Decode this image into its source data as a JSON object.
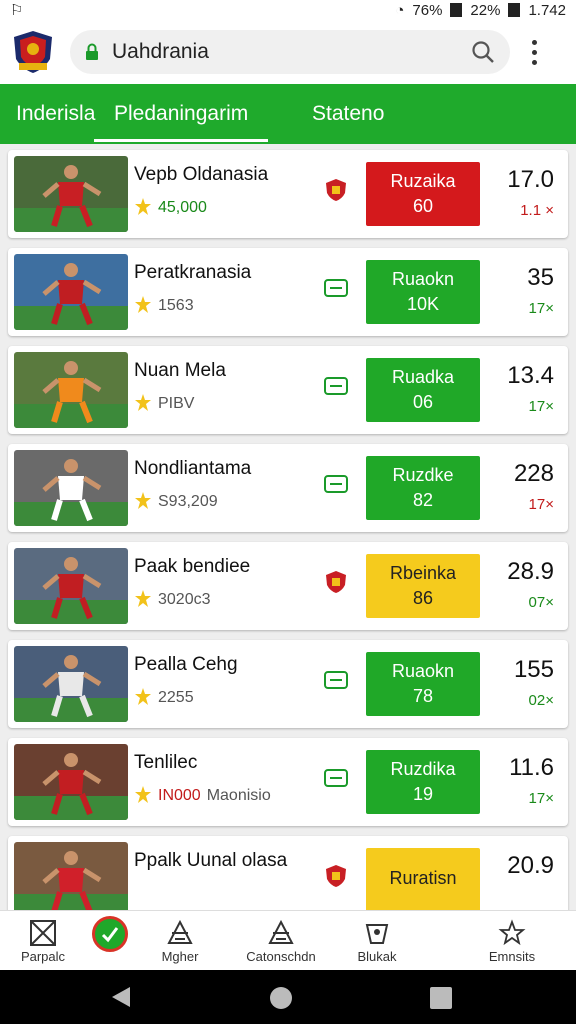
{
  "status": {
    "time": "1.742",
    "battery1": "76%",
    "battery2": "22%"
  },
  "browser": {
    "url": "Uahdrania"
  },
  "tabs": [
    {
      "label": "Inderisla",
      "active": false
    },
    {
      "label": "Pledaningarim",
      "active": true
    },
    {
      "label": "Stateno",
      "active": false
    }
  ],
  "cards": [
    {
      "name": "Vepb Oldanasia",
      "sub_value": "45,000",
      "sub_color": "green",
      "box_label": "Ruzaika",
      "box_value": "60",
      "box_color": "red",
      "score": "17.0",
      "change": "1.1 ×",
      "change_color": "red"
    },
    {
      "name": "Peratkranasia",
      "sub_value": "1563",
      "sub_color": "",
      "box_label": "Ruaokn",
      "box_value": "10K",
      "box_color": "green",
      "score": "35",
      "change": "17×",
      "change_color": "green"
    },
    {
      "name": "Nuan Mela",
      "sub_value": "PIBV",
      "sub_color": "",
      "box_label": "Ruadka",
      "box_value": "06",
      "box_color": "green",
      "score": "13.4",
      "change": "17×",
      "change_color": "green"
    },
    {
      "name": "Nondliantama",
      "sub_value": "S93,209",
      "sub_color": "",
      "box_label": "Ruzdke",
      "box_value": "82",
      "box_color": "green",
      "score": "228",
      "change": "17×",
      "change_color": "red"
    },
    {
      "name": "Paak bendiee",
      "sub_value": "3020c3",
      "sub_color": "",
      "box_label": "Rbeinka",
      "box_value": "86",
      "box_color": "yellow",
      "score": "28.9",
      "change": "07×",
      "change_color": "green"
    },
    {
      "name": "Pealla Cehg",
      "sub_value": "2255",
      "sub_color": "",
      "box_label": "Ruaokn",
      "box_value": "78",
      "box_color": "green",
      "score": "155",
      "change": "02×",
      "change_color": "green"
    },
    {
      "name": "Tenlilec",
      "sub_value": "IN000",
      "sub_color": "red",
      "sub_extra": "Maonisio",
      "box_label": "Ruzdika",
      "box_value": "19",
      "box_color": "green",
      "score": "11.6",
      "change": "17×",
      "change_color": "green"
    },
    {
      "name": "Ppalk Uunal olasa",
      "sub_value": "",
      "sub_color": "",
      "box_label": "Ruratisn",
      "box_value": "",
      "box_color": "yellow",
      "score": "20.9",
      "change": "",
      "change_color": "green"
    }
  ],
  "bottom_nav": [
    {
      "label": "Parpalc",
      "icon": "grid-icon"
    },
    {
      "label": "",
      "icon": "check-icon"
    },
    {
      "label": "Mgher",
      "icon": "stadium-icon"
    },
    {
      "label": "Catonschdn",
      "icon": "stadium-icon"
    },
    {
      "label": "Blukak",
      "icon": "team-icon"
    },
    {
      "label": "Emnsits",
      "icon": "star-icon"
    }
  ],
  "colors": {
    "tab_green": "#1faa2c",
    "box_red": "#d4191c",
    "box_green": "#20a828",
    "box_yellow": "#f5cb1d"
  }
}
